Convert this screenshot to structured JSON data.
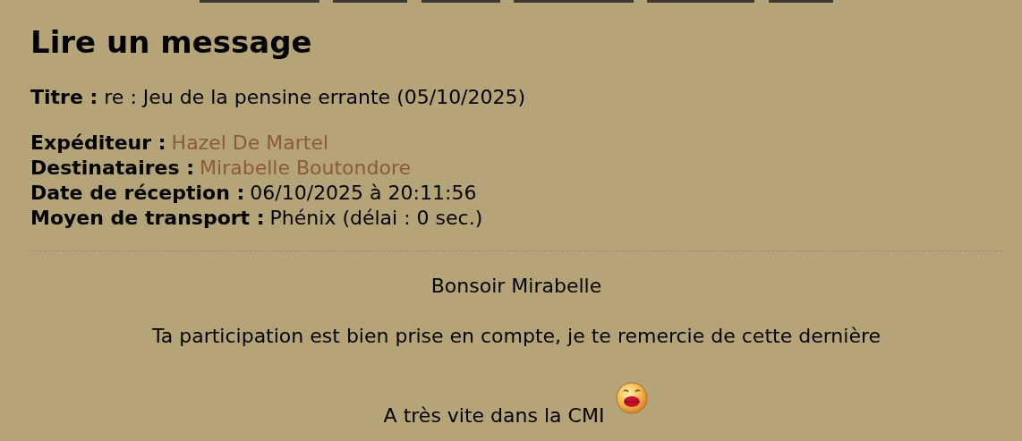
{
  "page_title": "Lire un message",
  "subject": {
    "label": "Titre :",
    "value": "re : Jeu de la pensine errante (05/10/2025)"
  },
  "meta": [
    {
      "label": "Expéditeur :",
      "value": "Hazel De Martel",
      "kind": "link"
    },
    {
      "label": "Destinataires :",
      "value": "Mirabelle Boutondore",
      "kind": "link"
    },
    {
      "label": "Date de réception :",
      "value": "06/10/2025 à 20:11:56",
      "kind": "text"
    },
    {
      "label": "Moyen de transport :",
      "value": "Phénix (délai : 0 sec.)",
      "kind": "text"
    }
  ],
  "body": [
    {
      "text": "Bonsoir Mirabelle",
      "kind": "plain"
    },
    {
      "text": "Ta participation est bien prise en compte, je te remercie de cette dernière",
      "kind": "plain"
    },
    {
      "text": "A très vite dans la CMI",
      "kind": "with_kiss_smiley"
    }
  ]
}
